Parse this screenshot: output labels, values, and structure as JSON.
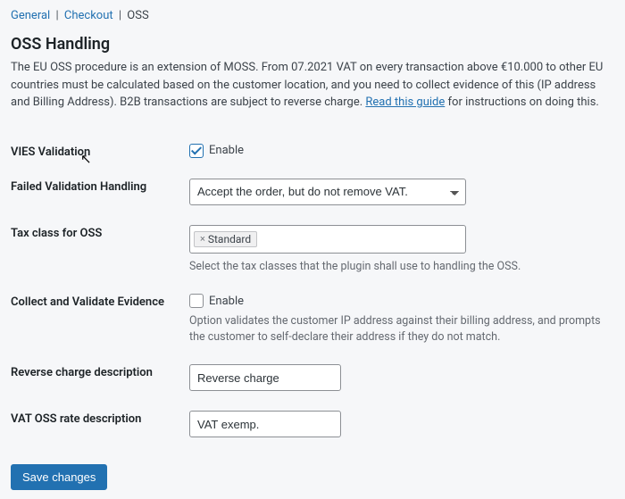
{
  "breadcrumb": {
    "items": [
      "General",
      "Checkout"
    ],
    "current": "OSS"
  },
  "heading": "OSS Handling",
  "intro_pre": "The EU OSS procedure is an extension of MOSS. From 07.2021 VAT on every transaction above €10.000 to other EU countries must be calculated based on the customer location, and you need to collect evidence of this (IP address and Billing Address). B2B transactions are subject to reverse charge. ",
  "intro_link": "Read this guide",
  "intro_post": " for instructions on doing this.",
  "fields": {
    "vies": {
      "label": "VIES Validation",
      "checkbox_label": "Enable",
      "checked": true
    },
    "failed_validation": {
      "label": "Failed Validation Handling",
      "selected": "Accept the order, but do not remove VAT."
    },
    "tax_class": {
      "label": "Tax class for OSS",
      "tag": "Standard",
      "help": "Select the tax classes that the plugin shall use to handling the OSS."
    },
    "evidence": {
      "label": "Collect and Validate Evidence",
      "checkbox_label": "Enable",
      "checked": false,
      "help": "Option validates the customer IP address against their billing address, and prompts the customer to self-declare their address if they do not match."
    },
    "reverse_charge": {
      "label": "Reverse charge description",
      "value": "Reverse charge"
    },
    "vat_oss": {
      "label": "VAT OSS rate description",
      "value": "VAT exemp."
    }
  },
  "submit_label": "Save changes"
}
